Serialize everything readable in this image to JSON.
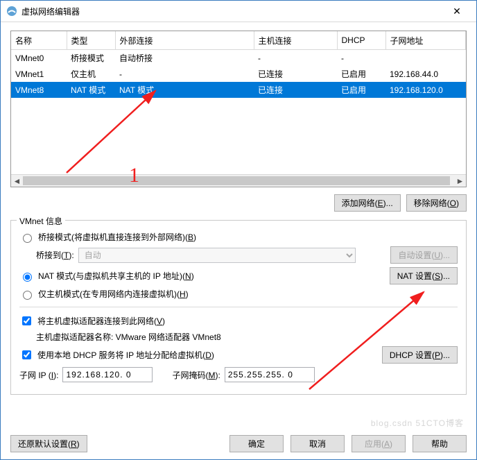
{
  "titlebar": {
    "title": "虚拟网络编辑器"
  },
  "table": {
    "cols": [
      "名称",
      "类型",
      "外部连接",
      "主机连接",
      "DHCP",
      "子网地址"
    ],
    "rows": [
      {
        "name": "VMnet0",
        "type": "桥接模式",
        "ext": "自动桥接",
        "host": "-",
        "dhcp": "-",
        "subnet": ""
      },
      {
        "name": "VMnet1",
        "type": "仅主机",
        "ext": "-",
        "host": "已连接",
        "dhcp": "已启用",
        "subnet": "192.168.44.0"
      },
      {
        "name": "VMnet8",
        "type": "NAT 模式",
        "ext": "NAT 模式",
        "host": "已连接",
        "dhcp": "已启用",
        "subnet": "192.168.120.0"
      }
    ],
    "selected_index": 2
  },
  "buttons": {
    "add_net": "添加网络(E)...",
    "remove_net": "移除网络(O)",
    "auto_set": "自动设置(U)...",
    "nat_set": "NAT 设置(S)...",
    "dhcp_set": "DHCP 设置(P)...",
    "restore": "还原默认设置(R)",
    "ok": "确定",
    "cancel": "取消",
    "apply": "应用(A)",
    "help": "帮助"
  },
  "group": {
    "legend": "VMnet 信息",
    "bridge_label": "桥接模式(将虚拟机直接连接到外部网络)(B)",
    "bridge_to": "桥接到(T):",
    "bridge_combo": "自动",
    "nat_label": "NAT 模式(与虚拟机共享主机的 IP 地址)(N)",
    "host_only_label": "仅主机模式(在专用网络内连接虚拟机)(H)",
    "host_adapter_chk": "将主机虚拟适配器连接到此网络(V)",
    "host_adapter_line": "主机虚拟适配器名称: VMware 网络适配器 VMnet8",
    "dhcp_chk": "使用本地 DHCP 服务将 IP 地址分配给虚拟机(D)",
    "subnet_ip_label": "子网 IP (I):",
    "subnet_ip": "192.168.120. 0",
    "subnet_mask_label": "子网掩码(M):",
    "subnet_mask": "255.255.255. 0"
  },
  "annotations": {
    "num1": "1"
  },
  "watermark": "blog.csdn 51CTO博客"
}
